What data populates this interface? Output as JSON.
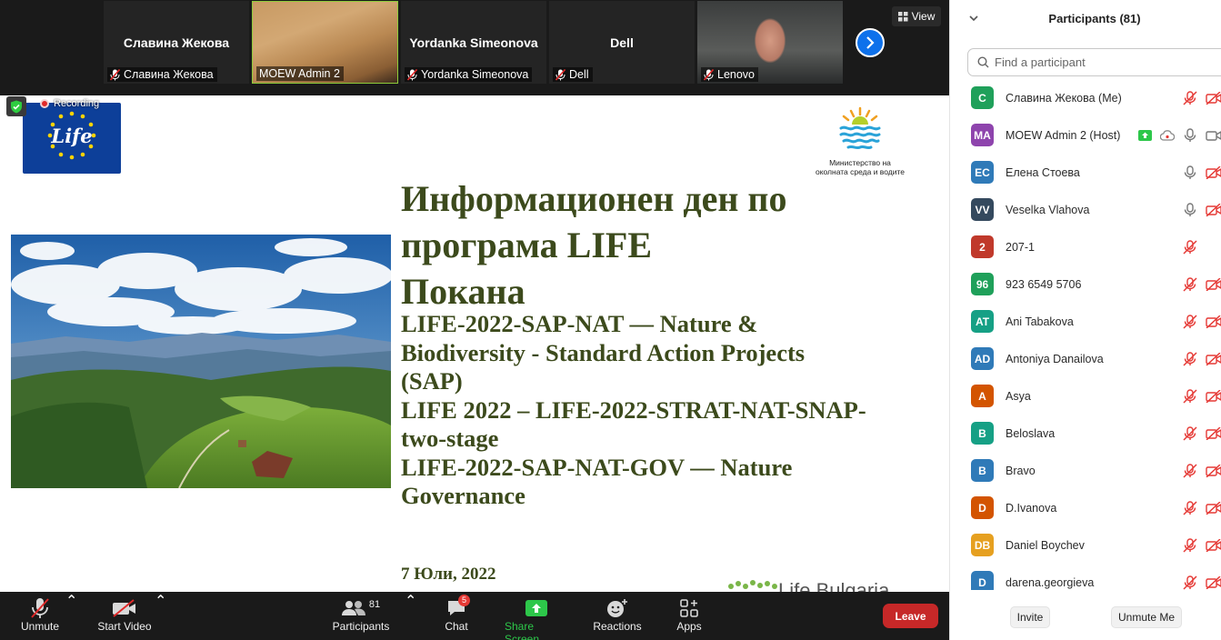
{
  "video_strip": {
    "tiles": [
      {
        "display": "Славина Жекова",
        "label": "Славина Жекова",
        "muted": true
      },
      {
        "display": "",
        "label": "MOEW Admin 2",
        "muted": false
      },
      {
        "display": "Yordanka  Simeonova",
        "label": "Yordanka Simeonova",
        "muted": true
      },
      {
        "display": "Dell",
        "label": "Dell",
        "muted": true
      },
      {
        "display": "",
        "label": "Lenovo",
        "muted": true
      }
    ],
    "view_label": "View"
  },
  "recording": {
    "label": "Recording"
  },
  "slide": {
    "title_lines": [
      "Информационен ден по",
      "програма LIFE",
      "Покана"
    ],
    "subtitle_lines": [
      "LIFE-2022-SAP-NAT — Nature &",
      "Biodiversity - Standard Action Projects",
      "(SAP)",
      "LIFE 2022 – LIFE-2022-STRAT-NAT-SNAP-",
      "two-stage",
      "LIFE-2022-SAP-NAT-GOV — Nature",
      "Governance"
    ],
    "date": "7 Юли, 2022",
    "eu_logo_text": "Life",
    "ministry_caption": [
      "Министерство на",
      "околната среда и водите"
    ],
    "bottom_logo_text": "Life Bulgaria"
  },
  "toolbar": {
    "unmute": "Unmute",
    "start_video": "Start Video",
    "participants": "Participants",
    "participants_count": "81",
    "chat": "Chat",
    "chat_badge": "5",
    "share_screen": "Share Screen",
    "reactions": "Reactions",
    "apps": "Apps",
    "leave": "Leave"
  },
  "panel": {
    "title": "Participants (81)",
    "search_placeholder": "Find a participant",
    "invite": "Invite",
    "unmute_me": "Unmute Me",
    "participants": [
      {
        "initials": "C",
        "name": "Славина Жекова (Me)",
        "color": "#1fa05a",
        "mic": "muted",
        "video": "off"
      },
      {
        "initials": "MA",
        "name": "MOEW Admin 2 (Host)",
        "color": "#8e44ad",
        "mic": "on",
        "video": "on",
        "share": true,
        "cloud": true
      },
      {
        "initials": "EC",
        "name": "Елена Стоева",
        "color": "#2f7ab8",
        "mic": "on",
        "video": "off"
      },
      {
        "initials": "VV",
        "name": "Veselka Vlahova",
        "color": "#34495e",
        "mic": "on",
        "video": "off"
      },
      {
        "initials": "2",
        "name": "207-1",
        "color": "#c0392b",
        "mic": "muted",
        "video": "none"
      },
      {
        "initials": "96",
        "name": "923 6549 5706",
        "color": "#1fa05a",
        "mic": "muted",
        "video": "off"
      },
      {
        "initials": "AT",
        "name": "Ani Tabakova",
        "color": "#16a085",
        "mic": "muted",
        "video": "off"
      },
      {
        "initials": "AD",
        "name": "Antoniya Danailova",
        "color": "#2f7ab8",
        "mic": "muted",
        "video": "off"
      },
      {
        "initials": "A",
        "name": "Asya",
        "color": "#d35400",
        "mic": "muted",
        "video": "off"
      },
      {
        "initials": "B",
        "name": "Beloslava",
        "color": "#16a085",
        "mic": "muted",
        "video": "off"
      },
      {
        "initials": "B",
        "name": "Bravo",
        "color": "#2f7ab8",
        "mic": "muted",
        "video": "off"
      },
      {
        "initials": "D",
        "name": "D.Ivanova",
        "color": "#d35400",
        "mic": "muted",
        "video": "off"
      },
      {
        "initials": "DB",
        "name": "Daniel Boychev",
        "color": "#e6a020",
        "mic": "muted",
        "video": "off"
      },
      {
        "initials": "D",
        "name": "darena.georgieva",
        "color": "#2f7ab8",
        "mic": "muted",
        "video": "off"
      }
    ]
  }
}
